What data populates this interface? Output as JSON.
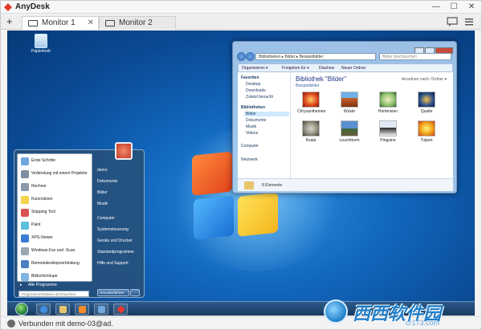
{
  "app": {
    "title": "AnyDesk"
  },
  "tabs": [
    {
      "label": "Monitor 1",
      "active": true
    },
    {
      "label": "Monitor 2",
      "active": false
    }
  ],
  "desktop": {
    "recycle_bin_label": "Papierkorb"
  },
  "explorer": {
    "address": "Bibliotheken ▸ Bilder ▸ Beispielbilder",
    "search_placeholder": "Bilder durchsuchen",
    "commands": [
      "Organisieren ▾",
      "Freigeben für ▾",
      "Diashow",
      "Neuer Ordner"
    ],
    "nav": {
      "favorites_header": "Favoriten",
      "favorites": [
        "Desktop",
        "Downloads",
        "Zuletzt besucht"
      ],
      "libraries_header": "Bibliotheken",
      "libraries": [
        "Bilder",
        "Dokumente",
        "Musik",
        "Videos"
      ],
      "computer": "Computer",
      "network": "Netzwerk"
    },
    "heading": "Bibliothek \"Bilder\"",
    "subheading": "Beispielbilder",
    "arrange": "Anordnen nach:  Ordner ▾",
    "thumbnails": [
      "Chrysanthemen",
      "Wüste",
      "Hortensien",
      "Qualle",
      "Koala",
      "Leuchtturm",
      "Pinguine",
      "Tulpen"
    ],
    "status": "8 Elemente"
  },
  "start_menu": {
    "programs": [
      "Erste Schritte",
      "Verbindung mit einem Projektor",
      "Rechner",
      "Kurznotizen",
      "Snipping Tool",
      "Paint",
      "XPS-Viewer",
      "Windows-Fax und -Scan",
      "Remotedesktopverbindung",
      "Bildschirmlupe"
    ],
    "all_programs": "Alle Programme",
    "search_placeholder": "Programme/Dateien durchsuchen",
    "right": [
      "demo",
      "Dokumente",
      "Bilder",
      "Musik",
      "Computer",
      "Systemsteuerung",
      "Geräte und Drucker",
      "Standardprogramme",
      "Hilfe und Support"
    ],
    "shutdown": "Herunterfahren"
  },
  "status_bar": {
    "text": "Verbunden mit demo-03@ad."
  },
  "watermark": {
    "text": "西西软件园",
    "sub": "cr173.com"
  }
}
